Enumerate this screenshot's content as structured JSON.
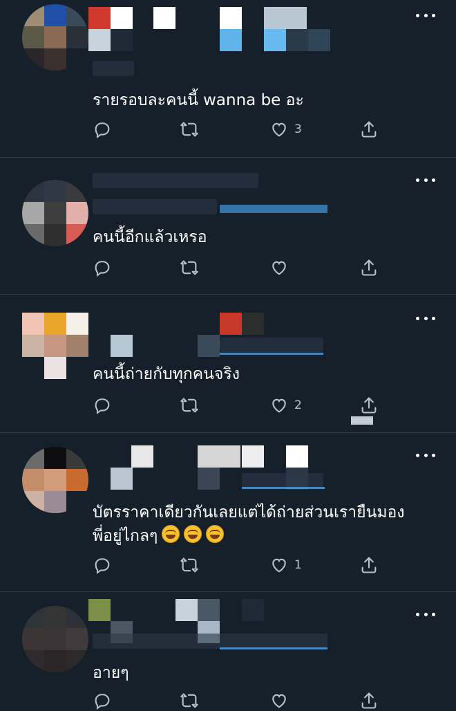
{
  "theme": {
    "background": "#15202b",
    "divider": "#2f3d4b",
    "text": "#ffffff",
    "muted": "#b8c2cc",
    "link": "#4b98d9"
  },
  "icons": {
    "reply": "reply-icon",
    "retweet": "retweet-icon",
    "like": "heart-icon",
    "share": "share-icon",
    "more": "more-options-icon"
  },
  "tweets": [
    {
      "text": "รายรอบละคนนี้ wanna be อะ",
      "likes": "3"
    },
    {
      "text": "คนนี้อีกแล้วเหรอ",
      "likes": ""
    },
    {
      "text": "คนนี้ถ่ายกับทุกคนจริง",
      "likes": "2"
    },
    {
      "text": "บัตรราคาเดียวกันเลยแต่ได้ถ่ายส่วนเรายืนมอง\nพี่อยู่ไกลๆ",
      "likes": "1"
    },
    {
      "text": "อายๆ",
      "likes": ""
    }
  ]
}
